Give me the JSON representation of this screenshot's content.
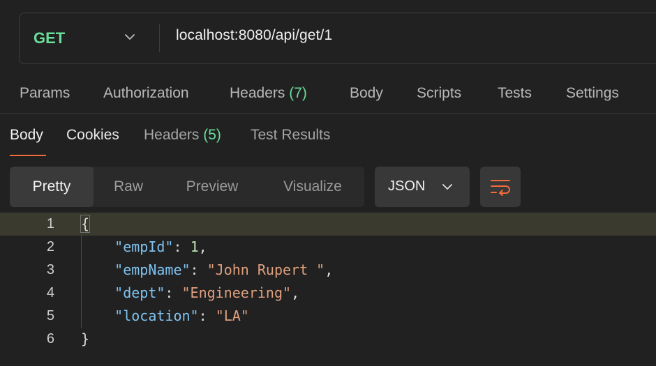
{
  "request": {
    "method": "GET",
    "url": "localhost:8080/api/get/1"
  },
  "request_tabs": [
    {
      "label": "Params",
      "count": ""
    },
    {
      "label": "Authorization",
      "count": ""
    },
    {
      "label": "Headers",
      "count": "(7)"
    },
    {
      "label": "Body",
      "count": ""
    },
    {
      "label": "Scripts",
      "count": ""
    },
    {
      "label": "Tests",
      "count": ""
    },
    {
      "label": "Settings",
      "count": ""
    }
  ],
  "response_tabs": [
    {
      "label": "Body",
      "count": "",
      "active": true
    },
    {
      "label": "Cookies",
      "count": ""
    },
    {
      "label": "Headers",
      "count": "(5)"
    },
    {
      "label": "Test Results",
      "count": ""
    }
  ],
  "view_modes": [
    {
      "label": "Pretty",
      "active": true
    },
    {
      "label": "Raw"
    },
    {
      "label": "Preview"
    },
    {
      "label": "Visualize"
    }
  ],
  "format": "JSON",
  "icons": {
    "method_dropdown": "chevron-down-icon",
    "format_dropdown": "chevron-down-icon",
    "wrap": "wrap-lines-icon"
  },
  "colors": {
    "method_get": "#6bdd9a",
    "tab_count": "#6bdd9a",
    "active_underline": "#f26b3a",
    "json_key": "#7fc3f0",
    "json_number": "#b9e2b1",
    "json_string": "#e0a07e"
  },
  "code": {
    "line_numbers": [
      "1",
      "2",
      "3",
      "4",
      "5",
      "6"
    ],
    "open_brace": "{",
    "close_brace": "}",
    "fields": [
      {
        "key": "\"empId\"",
        "value": "1",
        "type": "number",
        "trailing": ","
      },
      {
        "key": "\"empName\"",
        "value": "\"John Rupert \"",
        "type": "string",
        "trailing": ","
      },
      {
        "key": "\"dept\"",
        "value": "\"Engineering\"",
        "type": "string",
        "trailing": ","
      },
      {
        "key": "\"location\"",
        "value": "\"LA\"",
        "type": "string",
        "trailing": ""
      }
    ]
  }
}
